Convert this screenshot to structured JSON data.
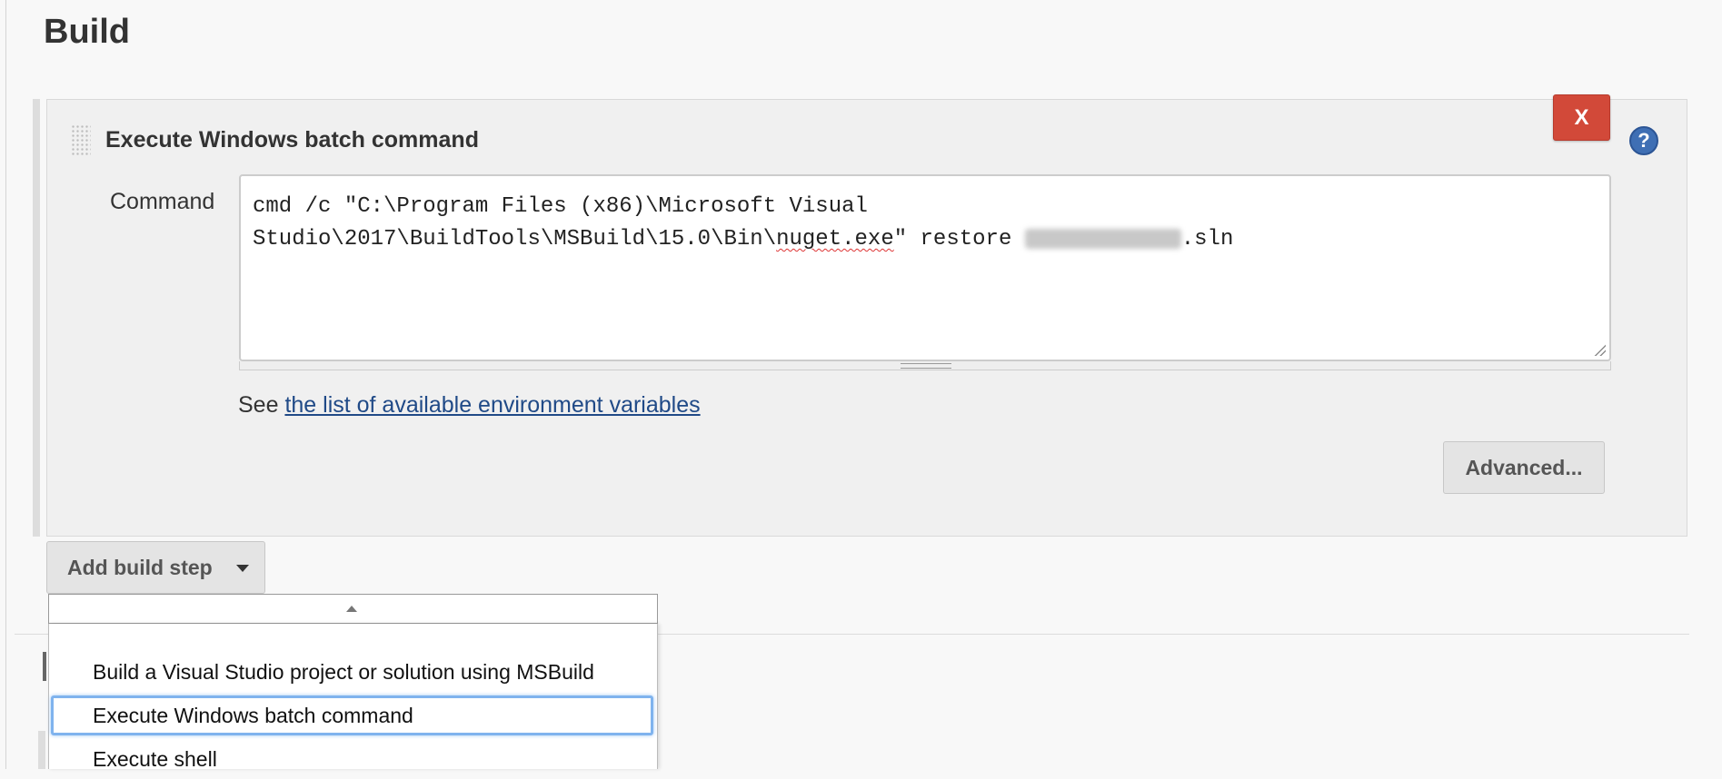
{
  "section": {
    "title": "Build"
  },
  "build_step": {
    "title": "Execute Windows batch command",
    "delete_label": "X",
    "help_icon": "question-mark",
    "command_label": "Command",
    "command_line1": "cmd /c \"C:\\Program Files (x86)\\Microsoft Visual",
    "command_line2_pre": "Studio\\2017\\BuildTools\\MSBuild\\15.0\\Bin\\",
    "command_line2_spell": "nuget.exe",
    "command_line2_mid": "\" restore ",
    "command_line2_post": ".sln",
    "env_prefix": "See ",
    "env_link": "the list of available environment variables",
    "advanced_label": "Advanced..."
  },
  "add_step": {
    "label": "Add build step"
  },
  "dropdown": {
    "items": [
      {
        "label": "Build a Visual Studio project or solution using MSBuild"
      },
      {
        "label": "Execute Windows batch command",
        "selected": true
      },
      {
        "label": "Execute shell"
      }
    ]
  },
  "colors": {
    "delete": "#d24939",
    "help": "#3f6fb4",
    "link": "#204a87",
    "selection": "#7fb3ee"
  }
}
